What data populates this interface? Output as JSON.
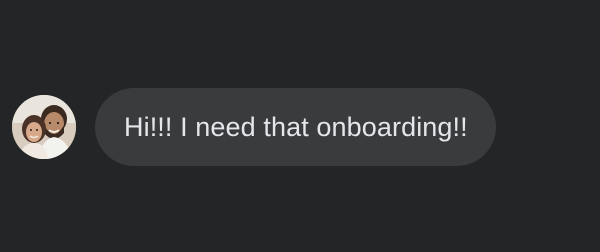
{
  "message": {
    "text": "Hi!!! I need that onboarding!!",
    "avatar_icon": "user-photo-avatar"
  },
  "colors": {
    "background": "#242526",
    "bubble": "#3a3b3c",
    "text": "#e4e6eb"
  }
}
